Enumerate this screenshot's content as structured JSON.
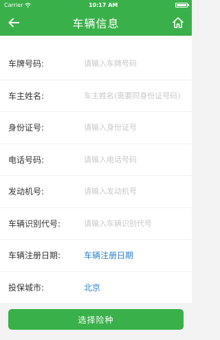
{
  "status": {
    "carrier": "Carrier",
    "time": "10:17 AM"
  },
  "header": {
    "title": "车辆信息"
  },
  "form": {
    "plate": {
      "label": "车牌号码:",
      "placeholder": "请输入车牌号码"
    },
    "owner": {
      "label": "车主姓名:",
      "placeholder": "车主姓名(需要同身份证号码)"
    },
    "id_card": {
      "label": "身份证号:",
      "placeholder": "请输入身份证号"
    },
    "phone": {
      "label": "电话号码:",
      "placeholder": "请输入电话号码"
    },
    "engine": {
      "label": "发动机号:",
      "placeholder": "请输入发动机号"
    },
    "vin": {
      "label": "车辆识别代号:",
      "placeholder": "请输入车辆识别代号"
    },
    "reg_date": {
      "label": "车辆注册日期:",
      "value": "车辆注册日期"
    },
    "city": {
      "label": "投保城市:",
      "value": "北京"
    }
  },
  "footer": {
    "submit_label": "选择险种"
  },
  "colors": {
    "brand": "#3ab04a",
    "link": "#2b7fd6"
  }
}
